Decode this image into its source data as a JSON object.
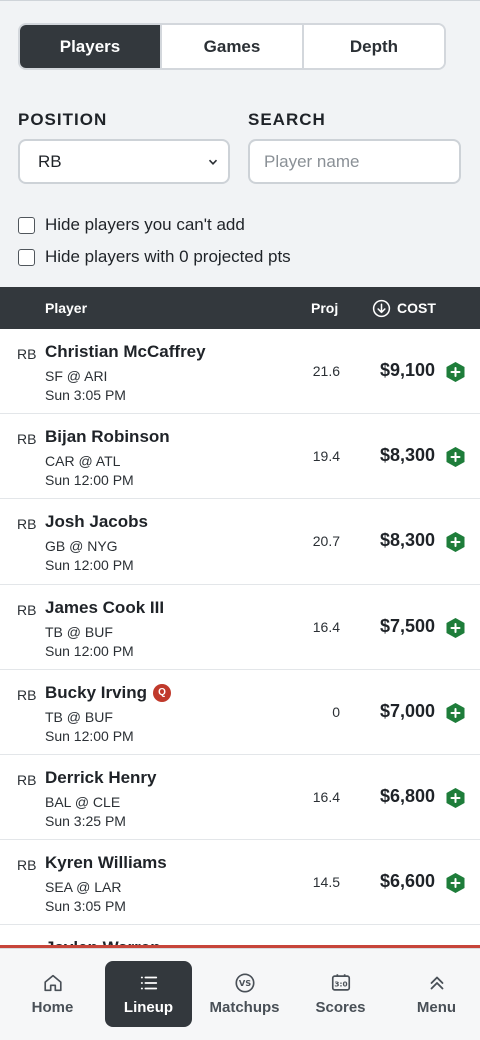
{
  "tabs": [
    {
      "label": "Players",
      "active": true
    },
    {
      "label": "Games",
      "active": false
    },
    {
      "label": "Depth",
      "active": false
    }
  ],
  "filters": {
    "position_label": "POSITION",
    "position_value": "RB",
    "search_label": "SEARCH",
    "search_placeholder": "Player name",
    "search_value": ""
  },
  "checkboxes": {
    "hide_cant_add": "Hide players you can't add",
    "hide_zero_proj": "Hide players with 0 projected pts"
  },
  "table": {
    "col_player": "Player",
    "col_proj": "Proj",
    "col_cost": "COST"
  },
  "players": [
    {
      "pos": "RB",
      "name": "Christian McCaffrey",
      "matchup": "SF @ ARI",
      "time": "Sun 3:05 PM",
      "proj": "21.6",
      "cost": "$9,100"
    },
    {
      "pos": "RB",
      "name": "Bijan Robinson",
      "matchup": "CAR @ ATL",
      "time": "Sun 12:00 PM",
      "proj": "19.4",
      "cost": "$8,300"
    },
    {
      "pos": "RB",
      "name": "Josh Jacobs",
      "matchup": "GB @ NYG",
      "time": "Sun 12:00 PM",
      "proj": "20.7",
      "cost": "$8,300"
    },
    {
      "pos": "RB",
      "name": "James Cook III",
      "matchup": "TB @ BUF",
      "time": "Sun 12:00 PM",
      "proj": "16.4",
      "cost": "$7,500"
    },
    {
      "pos": "RB",
      "name": "Bucky Irving",
      "status": "Q",
      "matchup": "TB @ BUF",
      "time": "Sun 12:00 PM",
      "proj": "0",
      "cost": "$7,000"
    },
    {
      "pos": "RB",
      "name": "Derrick Henry",
      "matchup": "BAL @ CLE",
      "time": "Sun 3:25 PM",
      "proj": "16.4",
      "cost": "$6,800"
    },
    {
      "pos": "RB",
      "name": "Kyren Williams",
      "matchup": "SEA @ LAR",
      "time": "Sun 3:05 PM",
      "proj": "14.5",
      "cost": "$6,600"
    },
    {
      "pos": "RB",
      "name": "Jaylen Warren",
      "matchup": "",
      "time": "",
      "proj": "",
      "cost": ""
    }
  ],
  "progress_fraction": 1.0,
  "nav": [
    {
      "label": "Home",
      "icon": "home-icon",
      "active": false
    },
    {
      "label": "Lineup",
      "icon": "list-icon",
      "active": true
    },
    {
      "label": "Matchups",
      "icon": "versus-icon",
      "active": false
    },
    {
      "label": "Scores",
      "icon": "scoreboard-icon",
      "active": false
    },
    {
      "label": "Menu",
      "icon": "chevrons-up-icon",
      "active": false
    }
  ],
  "colors": {
    "dark": "#33383d",
    "add_green": "#1e7d3a",
    "status_red": "#c0392b"
  }
}
